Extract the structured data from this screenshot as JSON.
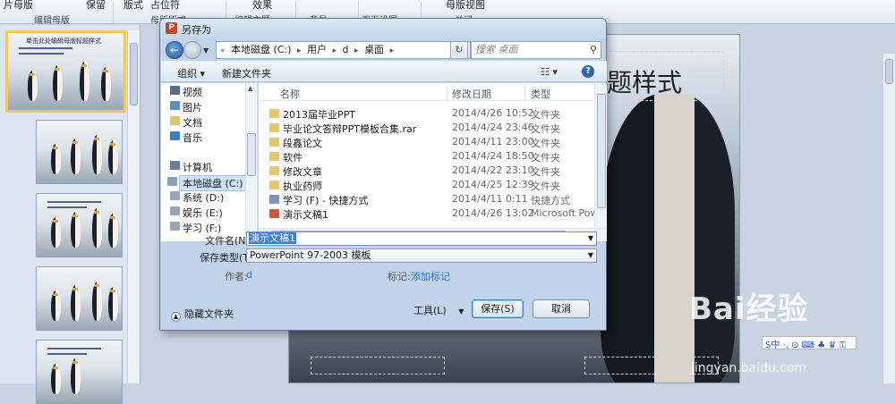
{
  "ribbon": {
    "top_items": [
      "片母版",
      "保留",
      "版式",
      "占位符",
      "效果"
    ],
    "groups": [
      "编辑母版",
      "母版版式",
      "编辑主题",
      "背景",
      "页面设置",
      "关闭"
    ],
    "close_view": "母版视图"
  },
  "slide": {
    "title_fragment": "题样式",
    "thumb_number": "1",
    "thumb_title": "单击此处编辑母版标题样式"
  },
  "watermark": {
    "brand": "Bai经验",
    "url": "jingyan.baidu.com",
    "ime": "S中 ·, ⊙ ⌨ ♣ ♛ ⚿"
  },
  "dialog": {
    "title": "另存为",
    "breadcrumbs": [
      "本地磁盘 (C:)",
      "用户",
      "d",
      "桌面"
    ],
    "search_placeholder": "搜索 桌面",
    "toolbar": {
      "organize": "组织 ▾",
      "new_folder": "新建文件夹",
      "view": "☷ ▾",
      "help": "?"
    },
    "nav": [
      {
        "label": "视频",
        "color": "#5a6d86"
      },
      {
        "label": "图片",
        "color": "#5d8fc4"
      },
      {
        "label": "文档",
        "color": "#e0c372"
      },
      {
        "label": "音乐",
        "color": "#3b7fc4"
      },
      {
        "label": "计算机",
        "color": "#6b7e97"
      },
      {
        "label": "本地磁盘 (C:)",
        "color": "#8aa0bb"
      },
      {
        "label": "系统 (D:)",
        "color": "#9aa6b5"
      },
      {
        "label": "娱乐 (E:)",
        "color": "#9aa6b5"
      },
      {
        "label": "学习 (F:)",
        "color": "#9aa6b5"
      }
    ],
    "columns": {
      "name": "名称",
      "date": "修改日期",
      "type": "类型"
    },
    "files": [
      {
        "name": "2013届毕业PPT",
        "date": "2014/4/26 10:52",
        "type": "文件夹",
        "color": "#e8c56a"
      },
      {
        "name": "毕业论文答辩PPT模板合集.rar",
        "date": "2014/4/24 23:46",
        "type": "文件夹",
        "color": "#e8c56a"
      },
      {
        "name": "段鑫论文",
        "date": "2014/4/11 23:00",
        "type": "文件夹",
        "color": "#e8c56a"
      },
      {
        "name": "软件",
        "date": "2014/4/24 18:50",
        "type": "文件夹",
        "color": "#e8c56a"
      },
      {
        "name": "修改文章",
        "date": "2014/4/22 23:10",
        "type": "文件夹",
        "color": "#e8c56a"
      },
      {
        "name": "执业药师",
        "date": "2014/4/25 12:39",
        "type": "文件夹",
        "color": "#e8c56a"
      },
      {
        "name": "学习 (F) - 快捷方式",
        "date": "2014/4/11 0:11",
        "type": "快捷方式",
        "color": "#7f97b5"
      },
      {
        "name": "演示文稿1",
        "date": "2014/4/26 13:02",
        "type": "Microsoft Powe",
        "color": "#d4553a"
      }
    ],
    "filename_label": "文件名(N):",
    "filename_value": "演示文稿1",
    "filetype_label": "保存类型(T):",
    "filetype_value": "PowerPoint 97-2003 模板",
    "author_label": "作者:",
    "author_value": "d",
    "tags_label": "标记:",
    "tags_value": "添加标记",
    "hide_folders": "隐藏文件夹",
    "tools": "工具(L)",
    "save": "保存(S)",
    "cancel": "取消"
  }
}
